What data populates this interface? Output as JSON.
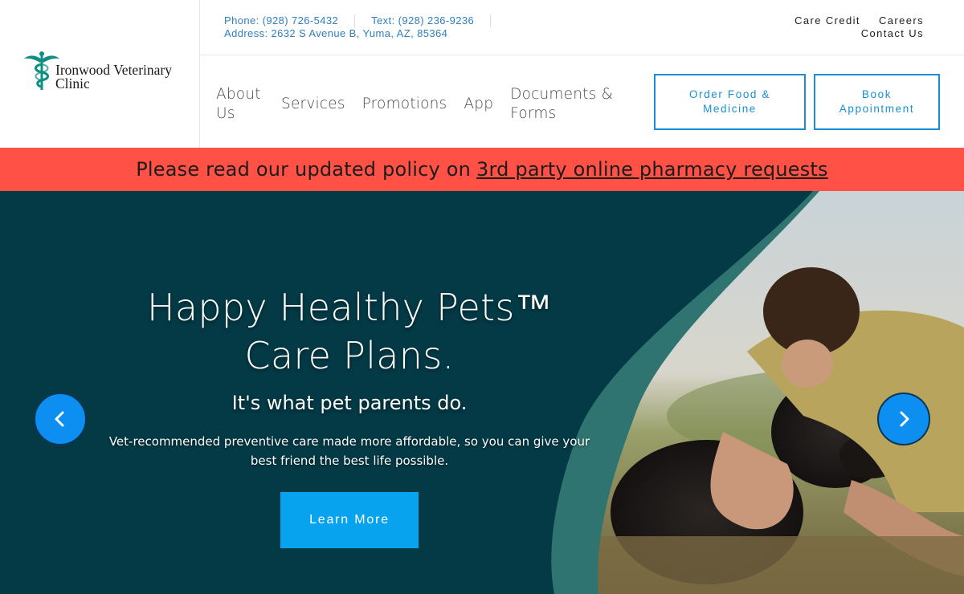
{
  "logo": {
    "line1": "Ironwood Veterinary",
    "line2": "Clinic",
    "icon": "caduceus-icon",
    "icon_color": "#0e8f84"
  },
  "contact": {
    "phone": "Phone: (928) 726-5432",
    "text": "Text: (928) 236-9236",
    "address": "Address: 2632 S Avenue B, Yuma, AZ, 85364"
  },
  "utility_links": {
    "care_credit": "Care Credit",
    "careers": "Careers",
    "contact_us": "Contact Us"
  },
  "nav": {
    "items": [
      {
        "label": "About Us"
      },
      {
        "label": "Services"
      },
      {
        "label": "Promotions"
      },
      {
        "label": "App"
      },
      {
        "label": "Documents & Forms"
      }
    ]
  },
  "cta": {
    "order": "Order Food & Medicine",
    "book": "Book Appointment"
  },
  "alert": {
    "text": "Please read our updated policy on",
    "link": "3rd party online pharmacy requests",
    "color": "#ff5145"
  },
  "hero": {
    "title_line1": "Happy Healthy Pets™",
    "title_line2": "Care Plans.",
    "subtitle": "It's what pet parents do.",
    "description": "Vet-recommended preventive care made more affordable, so you can give your best friend the best life possible.",
    "button": "Learn More",
    "prev_icon": "chevron-left-icon",
    "next_icon": "chevron-right-icon",
    "bg_color": "#033a46",
    "accent_color": "#07a3ee"
  }
}
